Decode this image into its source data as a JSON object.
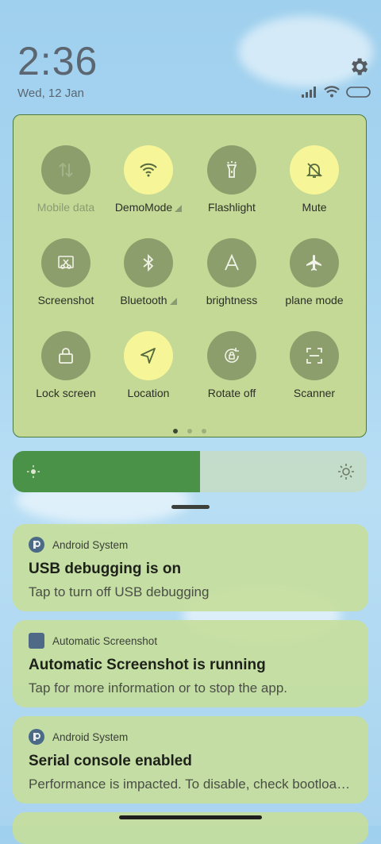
{
  "status": {
    "time": "2:36",
    "date": "Wed, 12 Jan",
    "settings_icon": "gear-icon",
    "signal_icon": "signal-icon",
    "wifi_icon": "wifi-icon",
    "battery_icon": "battery-icon"
  },
  "quick_settings": {
    "tiles": [
      {
        "label": "Mobile data",
        "icon": "mobile-data-icon",
        "on": false,
        "dim": true
      },
      {
        "label": "DemoMode",
        "icon": "wifi-icon",
        "on": true,
        "expand": true
      },
      {
        "label": "Flashlight",
        "icon": "flashlight-icon",
        "on": false
      },
      {
        "label": "Mute",
        "icon": "bell-off-icon",
        "on": true
      },
      {
        "label": "Screenshot",
        "icon": "screenshot-icon",
        "on": false
      },
      {
        "label": "Bluetooth",
        "icon": "bluetooth-icon",
        "on": false,
        "expand": true
      },
      {
        "label": "brightness",
        "icon": "auto-brightness-icon",
        "on": false
      },
      {
        "label": "plane mode",
        "icon": "airplane-icon",
        "on": false
      },
      {
        "label": "Lock screen",
        "icon": "lock-icon",
        "on": false
      },
      {
        "label": "Location",
        "icon": "location-icon",
        "on": true
      },
      {
        "label": "Rotate off",
        "icon": "rotate-lock-icon",
        "on": false
      },
      {
        "label": "Scanner",
        "icon": "scanner-icon",
        "on": false
      }
    ],
    "page_count": 3,
    "active_page": 1
  },
  "brightness": {
    "level": 0.53,
    "low_icon": "sun-small-icon",
    "high_icon": "sun-large-icon"
  },
  "notifications": [
    {
      "app": "Android System",
      "title": "USB debugging is on",
      "body": "Tap to turn off USB debugging"
    },
    {
      "app": "Automatic Screenshot",
      "title": "Automatic Screenshot is running",
      "body": "Tap for more information or to stop the app."
    },
    {
      "app": "Android System",
      "title": "Serial console enabled",
      "body": "Performance is impacted. To disable, check bootloader."
    }
  ]
}
